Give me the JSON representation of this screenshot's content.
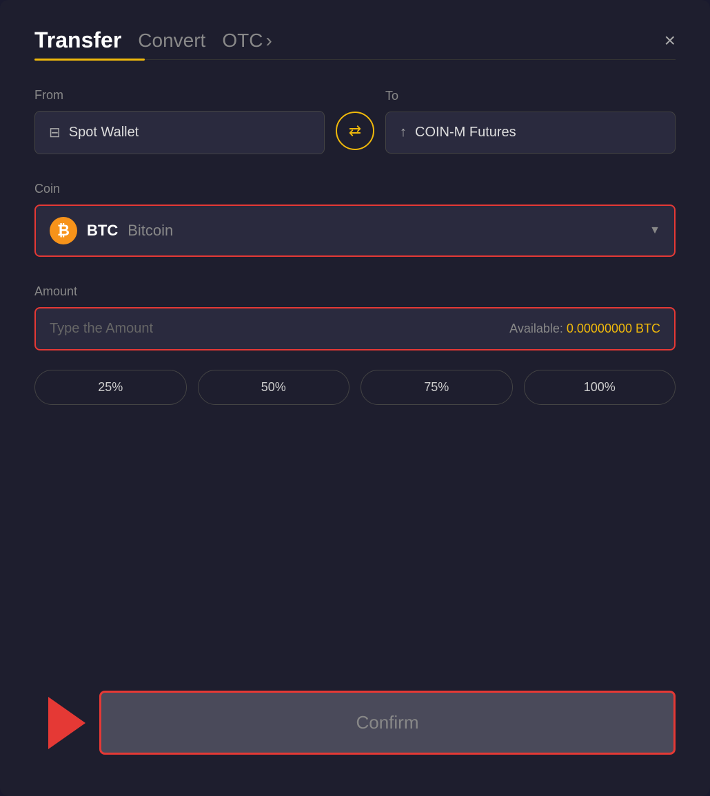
{
  "header": {
    "title": "Transfer",
    "tab_convert": "Convert",
    "tab_otc": "OTC",
    "close_label": "×"
  },
  "from": {
    "label": "From",
    "wallet_name": "Spot Wallet"
  },
  "to": {
    "label": "To",
    "wallet_name": "COIN-M Futures"
  },
  "coin": {
    "label": "Coin",
    "symbol": "BTC",
    "fullname": "Bitcoin"
  },
  "amount": {
    "label": "Amount",
    "placeholder": "Type the Amount",
    "available_label": "Available:",
    "available_value": "0.00000000 BTC"
  },
  "percentages": [
    {
      "label": "25%"
    },
    {
      "label": "50%"
    },
    {
      "label": "75%"
    },
    {
      "label": "100%"
    }
  ],
  "confirm_button": "Confirm"
}
